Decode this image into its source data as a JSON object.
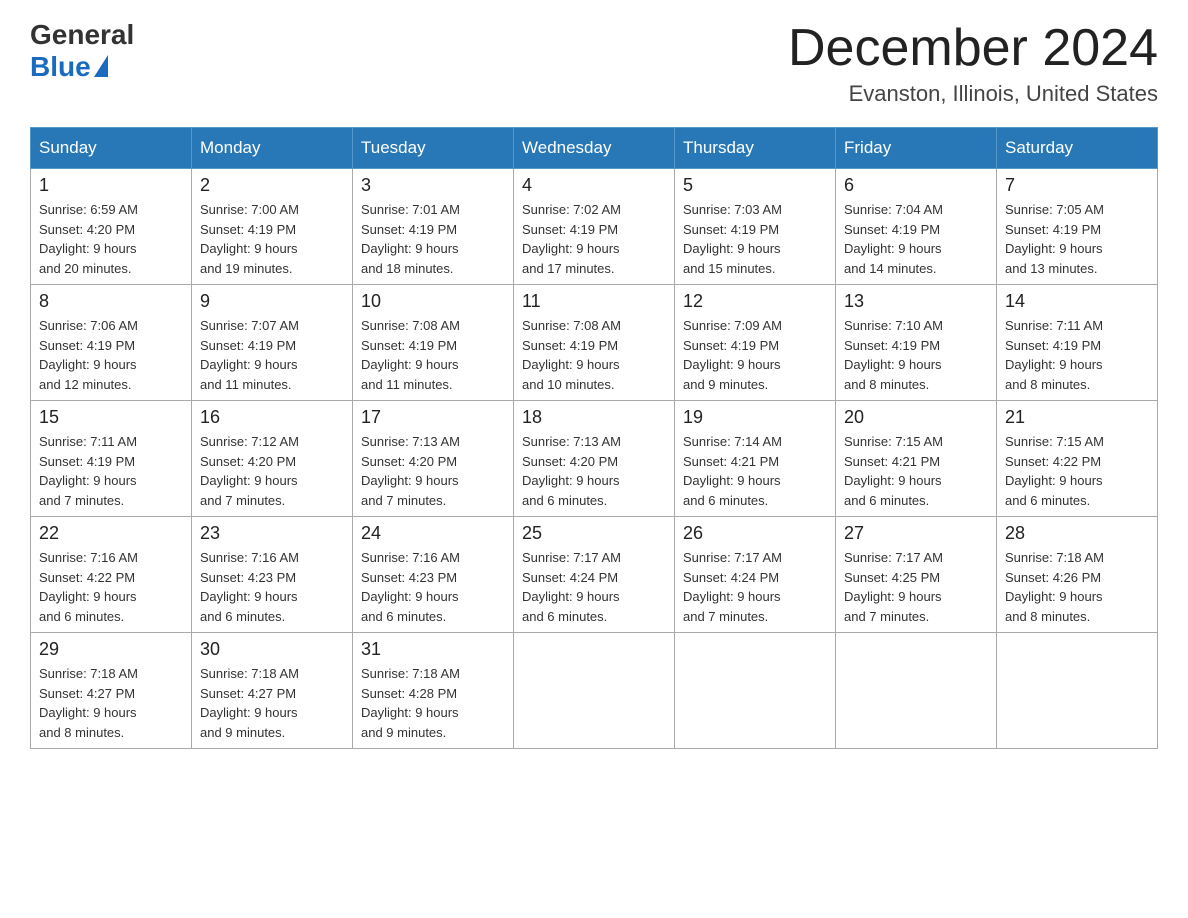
{
  "header": {
    "logo_general": "General",
    "logo_blue": "Blue",
    "month_title": "December 2024",
    "location": "Evanston, Illinois, United States"
  },
  "days_of_week": [
    "Sunday",
    "Monday",
    "Tuesday",
    "Wednesday",
    "Thursday",
    "Friday",
    "Saturday"
  ],
  "weeks": [
    [
      {
        "day": "1",
        "sunrise": "6:59 AM",
        "sunset": "4:20 PM",
        "daylight": "9 hours and 20 minutes."
      },
      {
        "day": "2",
        "sunrise": "7:00 AM",
        "sunset": "4:19 PM",
        "daylight": "9 hours and 19 minutes."
      },
      {
        "day": "3",
        "sunrise": "7:01 AM",
        "sunset": "4:19 PM",
        "daylight": "9 hours and 18 minutes."
      },
      {
        "day": "4",
        "sunrise": "7:02 AM",
        "sunset": "4:19 PM",
        "daylight": "9 hours and 17 minutes."
      },
      {
        "day": "5",
        "sunrise": "7:03 AM",
        "sunset": "4:19 PM",
        "daylight": "9 hours and 15 minutes."
      },
      {
        "day": "6",
        "sunrise": "7:04 AM",
        "sunset": "4:19 PM",
        "daylight": "9 hours and 14 minutes."
      },
      {
        "day": "7",
        "sunrise": "7:05 AM",
        "sunset": "4:19 PM",
        "daylight": "9 hours and 13 minutes."
      }
    ],
    [
      {
        "day": "8",
        "sunrise": "7:06 AM",
        "sunset": "4:19 PM",
        "daylight": "9 hours and 12 minutes."
      },
      {
        "day": "9",
        "sunrise": "7:07 AM",
        "sunset": "4:19 PM",
        "daylight": "9 hours and 11 minutes."
      },
      {
        "day": "10",
        "sunrise": "7:08 AM",
        "sunset": "4:19 PM",
        "daylight": "9 hours and 11 minutes."
      },
      {
        "day": "11",
        "sunrise": "7:08 AM",
        "sunset": "4:19 PM",
        "daylight": "9 hours and 10 minutes."
      },
      {
        "day": "12",
        "sunrise": "7:09 AM",
        "sunset": "4:19 PM",
        "daylight": "9 hours and 9 minutes."
      },
      {
        "day": "13",
        "sunrise": "7:10 AM",
        "sunset": "4:19 PM",
        "daylight": "9 hours and 8 minutes."
      },
      {
        "day": "14",
        "sunrise": "7:11 AM",
        "sunset": "4:19 PM",
        "daylight": "9 hours and 8 minutes."
      }
    ],
    [
      {
        "day": "15",
        "sunrise": "7:11 AM",
        "sunset": "4:19 PM",
        "daylight": "9 hours and 7 minutes."
      },
      {
        "day": "16",
        "sunrise": "7:12 AM",
        "sunset": "4:20 PM",
        "daylight": "9 hours and 7 minutes."
      },
      {
        "day": "17",
        "sunrise": "7:13 AM",
        "sunset": "4:20 PM",
        "daylight": "9 hours and 7 minutes."
      },
      {
        "day": "18",
        "sunrise": "7:13 AM",
        "sunset": "4:20 PM",
        "daylight": "9 hours and 6 minutes."
      },
      {
        "day": "19",
        "sunrise": "7:14 AM",
        "sunset": "4:21 PM",
        "daylight": "9 hours and 6 minutes."
      },
      {
        "day": "20",
        "sunrise": "7:15 AM",
        "sunset": "4:21 PM",
        "daylight": "9 hours and 6 minutes."
      },
      {
        "day": "21",
        "sunrise": "7:15 AM",
        "sunset": "4:22 PM",
        "daylight": "9 hours and 6 minutes."
      }
    ],
    [
      {
        "day": "22",
        "sunrise": "7:16 AM",
        "sunset": "4:22 PM",
        "daylight": "9 hours and 6 minutes."
      },
      {
        "day": "23",
        "sunrise": "7:16 AM",
        "sunset": "4:23 PM",
        "daylight": "9 hours and 6 minutes."
      },
      {
        "day": "24",
        "sunrise": "7:16 AM",
        "sunset": "4:23 PM",
        "daylight": "9 hours and 6 minutes."
      },
      {
        "day": "25",
        "sunrise": "7:17 AM",
        "sunset": "4:24 PM",
        "daylight": "9 hours and 6 minutes."
      },
      {
        "day": "26",
        "sunrise": "7:17 AM",
        "sunset": "4:24 PM",
        "daylight": "9 hours and 7 minutes."
      },
      {
        "day": "27",
        "sunrise": "7:17 AM",
        "sunset": "4:25 PM",
        "daylight": "9 hours and 7 minutes."
      },
      {
        "day": "28",
        "sunrise": "7:18 AM",
        "sunset": "4:26 PM",
        "daylight": "9 hours and 8 minutes."
      }
    ],
    [
      {
        "day": "29",
        "sunrise": "7:18 AM",
        "sunset": "4:27 PM",
        "daylight": "9 hours and 8 minutes."
      },
      {
        "day": "30",
        "sunrise": "7:18 AM",
        "sunset": "4:27 PM",
        "daylight": "9 hours and 9 minutes."
      },
      {
        "day": "31",
        "sunrise": "7:18 AM",
        "sunset": "4:28 PM",
        "daylight": "9 hours and 9 minutes."
      },
      null,
      null,
      null,
      null
    ]
  ],
  "labels": {
    "sunrise": "Sunrise:",
    "sunset": "Sunset:",
    "daylight": "Daylight:"
  }
}
